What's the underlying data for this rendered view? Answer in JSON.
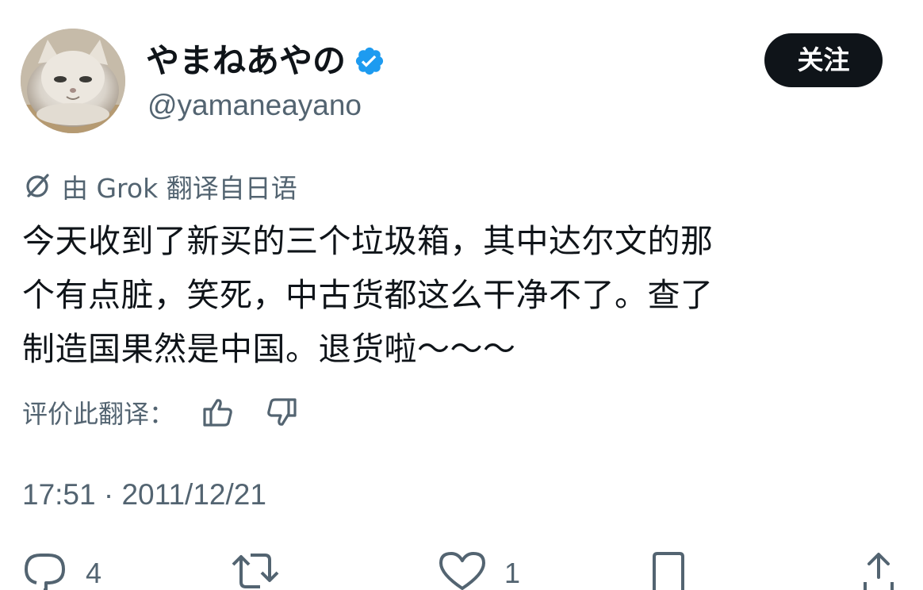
{
  "user": {
    "display_name": "やまねあやの",
    "handle": "@yamaneayano",
    "verified_icon": "verified-badge-icon",
    "follow_label": "关注"
  },
  "translation": {
    "note": "由 Grok 翻译自日语",
    "rate_label": "评价此翻译："
  },
  "tweet": {
    "lines": [
      "今天收到了新买的三个垃圾箱，其中达尔文的那",
      "个有点脏，笑死，中古货都这么干净不了。查了",
      "制造国果然是中国。退货啦～～～"
    ],
    "timestamp": "17:51 · 2011/12/21"
  },
  "actions": {
    "reply_count": "4",
    "retweet_count": "",
    "like_count": "1"
  },
  "colors": {
    "text": "#0f1419",
    "secondary": "#536471",
    "verified": "#1d9bf0",
    "button_bg": "#0f1419"
  }
}
